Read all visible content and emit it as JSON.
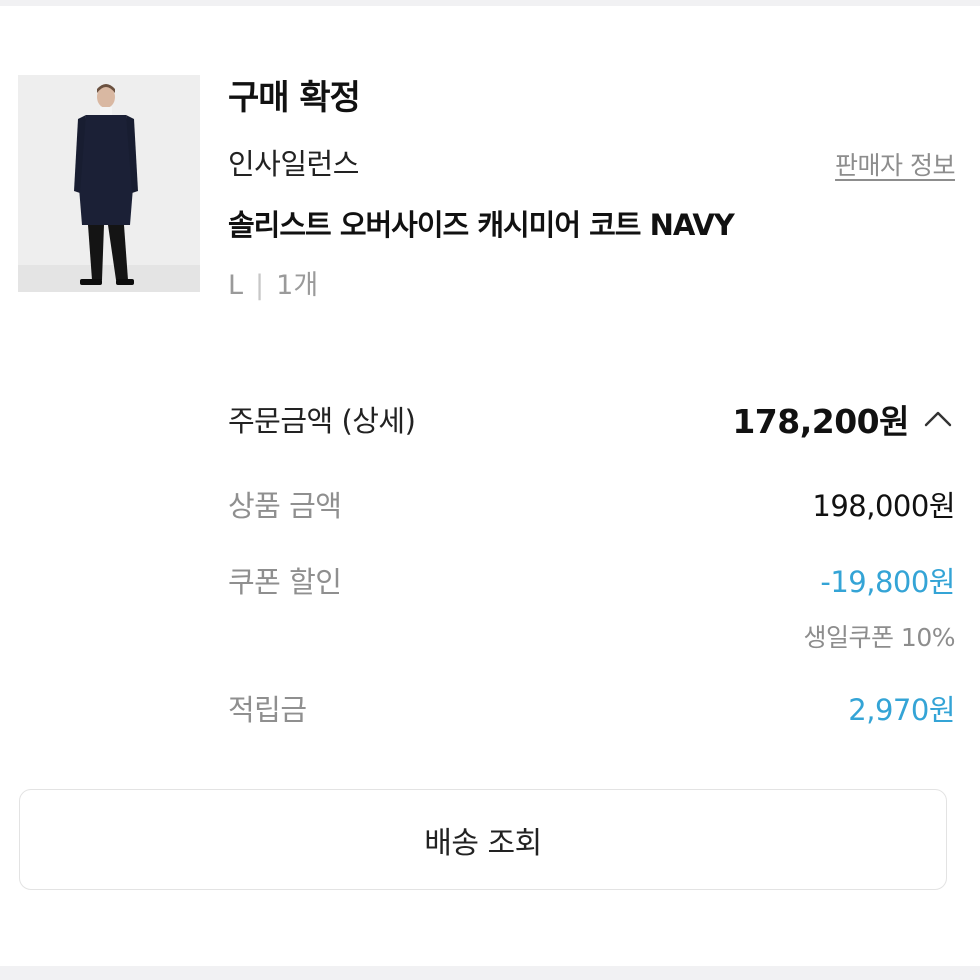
{
  "order": {
    "status": "구매 확정",
    "seller_name": "인사일런스",
    "seller_info_link": "판매자 정보",
    "product_name": "솔리스트 오버사이즈 캐시미어 코트 NAVY",
    "option_size": "L",
    "option_separator": "|",
    "option_quantity": "1개"
  },
  "summary": {
    "total_label": "주문금액 (상세)",
    "total_value": "178,200원",
    "items_label": "상품 금액",
    "items_value": "198,000원",
    "coupon_label": "쿠폰 할인",
    "coupon_value": "-19,800원",
    "coupon_note": "생일쿠폰 10%",
    "points_label": "적립금",
    "points_value": "2,970원"
  },
  "actions": {
    "track_delivery_label": "배송 조회"
  },
  "colors": {
    "accent_blue": "#34a4d6",
    "muted_text": "#8f8f8f",
    "divider": "#f1f1f3"
  },
  "icons": {
    "expand_toggle": "chevron-up-icon"
  }
}
